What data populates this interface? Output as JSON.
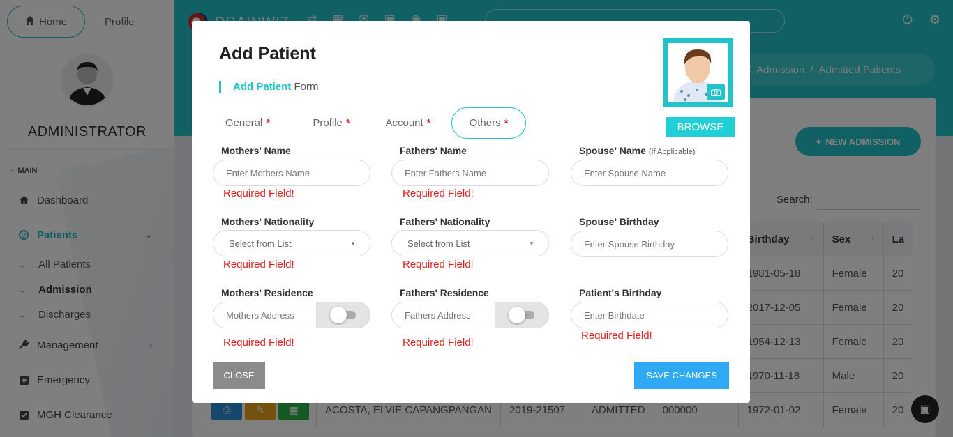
{
  "nav": {
    "home": "Home",
    "profile": "Profile"
  },
  "sidebar": {
    "admin_name": "ADMINISTRATOR",
    "section": "-- MAIN",
    "items": [
      {
        "label": "Dashboard",
        "icon": "home-icon"
      },
      {
        "label": "Patients",
        "icon": "smile-icon",
        "active": true
      },
      {
        "label": "Management",
        "icon": "wrench-icon"
      },
      {
        "label": "Emergency",
        "icon": "plus-square-icon"
      },
      {
        "label": "MGH Clearance",
        "icon": "check-square-icon"
      }
    ],
    "sub_items": [
      "All Patients",
      "Admission",
      "Discharges"
    ]
  },
  "header": {
    "brand": "DRAINWIZ"
  },
  "breadcrumb": {
    "parent": "Admission",
    "current": "Admitted Patients"
  },
  "page": {
    "new_admission": "NEW ADMISSION",
    "search_label": "Search:"
  },
  "table": {
    "columns": [
      "Birthday",
      "Sex",
      "La"
    ],
    "rows": [
      {
        "birthday": "1981-05-18",
        "sex": "Female",
        "trunc": "20"
      },
      {
        "birthday": "2017-12-05",
        "sex": "Female",
        "trunc": "20"
      },
      {
        "birthday": "1954-12-13",
        "sex": "Female",
        "trunc": "20"
      },
      {
        "birthday": "1970-11-18",
        "sex": "Male",
        "trunc": "20"
      },
      {
        "name": "ACOSTA, ELVIE CAPANGPANGAN",
        "case_no": "2019-21507",
        "status": "ADMITTED",
        "code": "000000",
        "birthday": "1972-01-02",
        "sex": "Female",
        "trunc": "20"
      }
    ]
  },
  "modal": {
    "title": "Add Patient",
    "subtitle_highlight": "Add Patient",
    "subtitle_rest": "Form",
    "browse": "BROWSE",
    "tabs": [
      {
        "label": "General",
        "req": "*"
      },
      {
        "label": "Profile",
        "req": "*"
      },
      {
        "label": "Account",
        "req": "*"
      },
      {
        "label": "Others",
        "req": "*",
        "active": true
      }
    ],
    "fields": {
      "mothers_name": {
        "label": "Mothers' Name",
        "placeholder": "Enter Mothers Name",
        "error": "Required Field!"
      },
      "fathers_name": {
        "label": "Fathers' Name",
        "placeholder": "Enter Fathers Name",
        "error": "Required Field!"
      },
      "spouse_name": {
        "label": "Spouse' Name",
        "hint": "(If Applicable)",
        "placeholder": "Enter Spouse Name"
      },
      "mothers_nationality": {
        "label": "Mothers' Nationality",
        "value": "Select from List",
        "error": "Required Field!"
      },
      "fathers_nationality": {
        "label": "Fathers' Nationality",
        "value": "Select from List",
        "error": "Required Field!"
      },
      "spouse_birthday": {
        "label": "Spouse' Birthday",
        "placeholder": "Enter Spouse Birthday"
      },
      "mothers_residence": {
        "label": "Mothers' Residence",
        "placeholder": "Mothers Address",
        "error": "Required Field!"
      },
      "fathers_residence": {
        "label": "Fathers' Residence",
        "placeholder": "Fathers Address",
        "error": "Required Field!"
      },
      "patient_birthday": {
        "label": "Patient's Birthday",
        "placeholder": "Enter Birthdate",
        "error": "Required Field!"
      }
    },
    "close": "CLOSE",
    "save": "SAVE CHANGES"
  },
  "colors": {
    "accent": "#22c3c9",
    "error": "#e02020",
    "save": "#2fa9f4",
    "close": "#8b8b8b"
  }
}
